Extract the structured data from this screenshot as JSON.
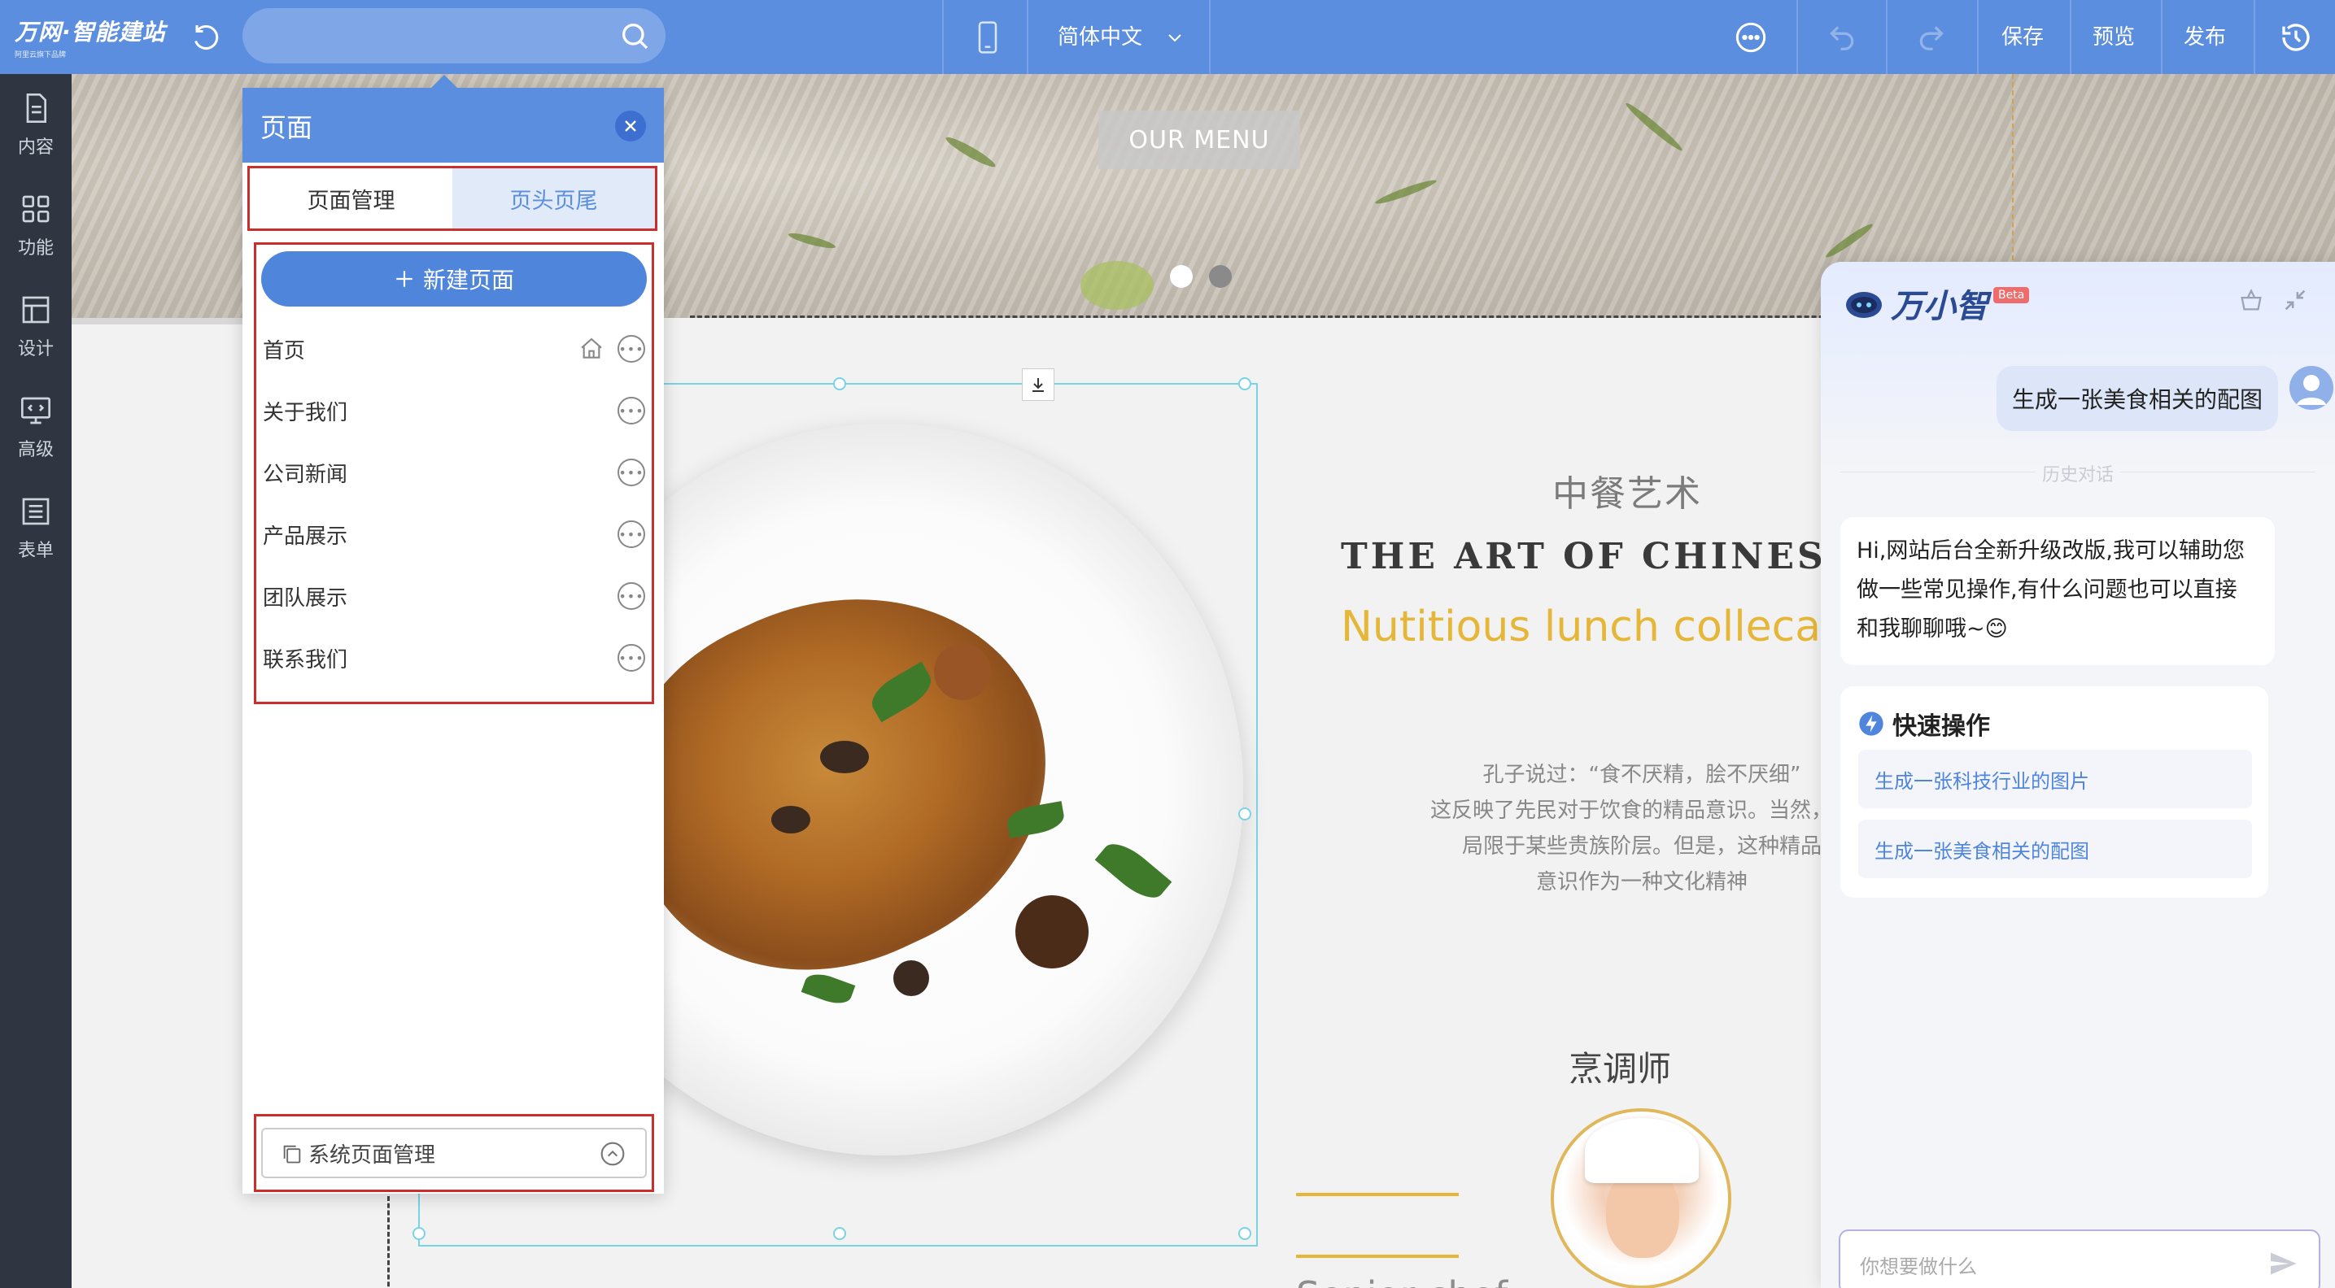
{
  "topbar": {
    "brand": "万网·智能建站",
    "tagline": "阿里云旗下品牌",
    "language": "简体中文",
    "save_label": "保存",
    "preview_label": "预览",
    "publish_label": "发布"
  },
  "rail": {
    "items": [
      {
        "label": "内容",
        "icon": "document-icon"
      },
      {
        "label": "功能",
        "icon": "grid-icon"
      },
      {
        "label": "设计",
        "icon": "layout-icon"
      },
      {
        "label": "高级",
        "icon": "code-monitor-icon"
      },
      {
        "label": "表单",
        "icon": "form-list-icon"
      }
    ]
  },
  "canvas": {
    "menu_button": "OUR MENU",
    "cn_title": "中餐艺术",
    "en_title": "THE ART OF CHINESE",
    "yellow_title": "Nutitious lunch collecati",
    "paragraph": [
      "孔子说过：“食不厌精，脍不厌细”",
      "这反映了先民对于饮食的精品意识。当然，这",
      "局限于某些贵族阶层。但是，这种精品",
      "意识作为一种文化精神"
    ],
    "chef_title": "烹调师",
    "senior_chef": "Senior chef",
    "colors": {
      "accent": "#e5b637",
      "selection": "#7ad3e5"
    }
  },
  "pages_panel": {
    "title": "页面",
    "tabs": [
      {
        "label": "页面管理",
        "active": true
      },
      {
        "label": "页头页尾",
        "active": false
      }
    ],
    "new_page_label": "新建页面",
    "pages": [
      {
        "label": "首页",
        "home": true
      },
      {
        "label": "关于我们",
        "home": false
      },
      {
        "label": "公司新闻",
        "home": false
      },
      {
        "label": "产品展示",
        "home": false
      },
      {
        "label": "团队展示",
        "home": false
      },
      {
        "label": "联系我们",
        "home": false
      }
    ],
    "system_pages_label": "系统页面管理"
  },
  "chat": {
    "name": "万小智",
    "badge": "Beta",
    "user_message": "生成一张美食相关的配图",
    "history_divider": "历史对话",
    "bot_message": "Hi,网站后台全新升级改版,我可以辅助您做一些常见操作,有什么问题也可以直接和我聊聊哦~😊",
    "quick_title": "快速操作",
    "quick_actions": [
      "生成一张科技行业的图片",
      "生成一张美食相关的配图"
    ],
    "input_placeholder": "你想要做什么"
  }
}
